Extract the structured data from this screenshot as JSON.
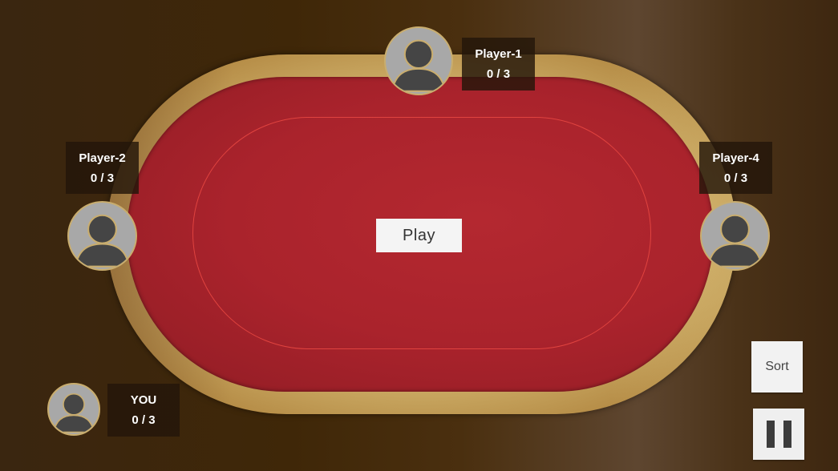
{
  "players": {
    "top": {
      "name": "Player-1",
      "score": "0 / 3"
    },
    "left": {
      "name": "Player-2",
      "score": "0 / 3"
    },
    "right": {
      "name": "Player-4",
      "score": "0 / 3"
    },
    "you": {
      "name": "YOU",
      "score": "0 / 3"
    }
  },
  "controls": {
    "play_label": "Play",
    "sort_label": "Sort",
    "pause_icon": "pause-icon"
  },
  "colors": {
    "felt": "#aa232c",
    "felt_line": "#e0433f",
    "rail": "#cfb06a",
    "avatar_ring": "#c9ad6e",
    "avatar_bg": "#a8a8a8",
    "avatar_figure": "#454545"
  },
  "icons": {
    "avatar": "user-avatar-icon"
  }
}
